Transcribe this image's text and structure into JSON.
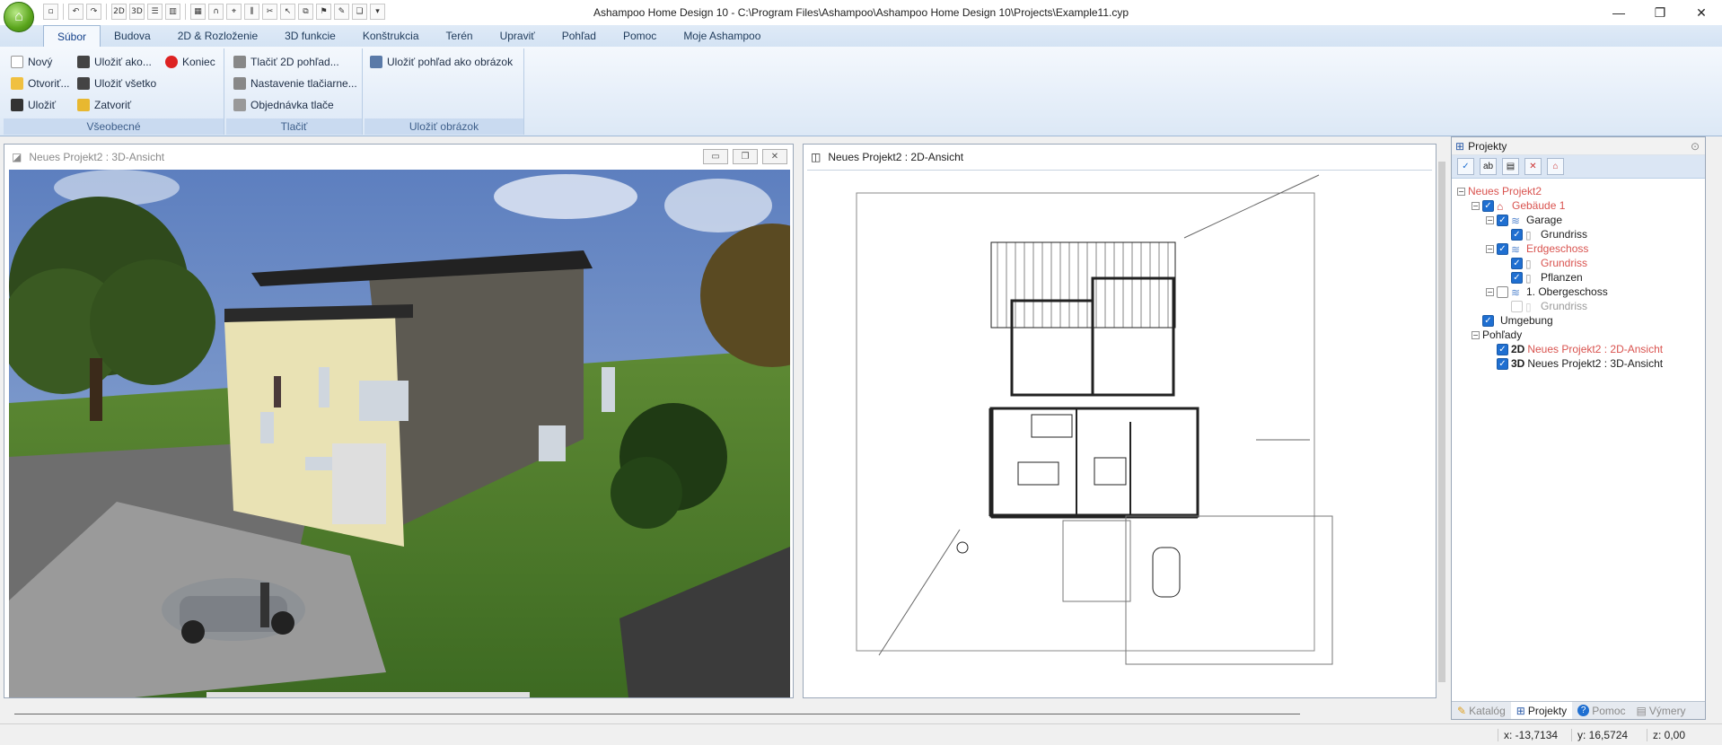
{
  "window": {
    "title": "Ashampoo Home Design 10 - C:\\Program Files\\Ashampoo\\Ashampoo Home Design 10\\Projects\\Example11.cyp",
    "minimize": "—",
    "maximize": "❐",
    "close": "✕"
  },
  "qat": {
    "btn_2d": "2D",
    "btn_3d": "3D"
  },
  "ribbon": {
    "tabs": [
      "Súbor",
      "Budova",
      "2D & Rozloženie",
      "3D funkcie",
      "Konštrukcia",
      "Terén",
      "Upraviť",
      "Pohľad",
      "Pomoc",
      "Moje Ashampoo"
    ],
    "groups": {
      "vseobecne": {
        "label": "Všeobecné",
        "items": [
          "Nový",
          "Otvoriť...",
          "Uložiť",
          "Uložiť ako...",
          "Uložiť všetko",
          "Zatvoriť",
          "Koniec"
        ]
      },
      "tlacit": {
        "label": "Tlačiť",
        "items": [
          "Tlačiť 2D pohľad...",
          "Nastavenie tlačiarne...",
          "Objednávka tlače"
        ]
      },
      "ulozit_obrazok": {
        "label": "Uložiť obrázok",
        "items": [
          "Uložiť pohľad ako obrázok"
        ]
      }
    }
  },
  "views": {
    "view3d_title": "Neues Projekt2 : 3D-Ansicht",
    "view2d_title": "Neues Projekt2 : 2D-Ansicht"
  },
  "project_panel": {
    "title": "Projekty",
    "tree": [
      {
        "label": "Neues Projekt2"
      },
      {
        "label": "Gebäude 1"
      },
      {
        "label": "Garage"
      },
      {
        "label": "Grundriss"
      },
      {
        "label": "Erdgeschoss"
      },
      {
        "label": "Grundriss"
      },
      {
        "label": "Pflanzen"
      },
      {
        "label": "1. Obergeschoss"
      },
      {
        "label": "Grundriss"
      },
      {
        "label": "Umgebung"
      },
      {
        "label": "Pohľady"
      },
      {
        "label": "Neues Projekt2 : 2D-Ansicht",
        "badge": "2D"
      },
      {
        "label": "Neues Projekt2 : 3D-Ansicht",
        "badge": "3D"
      }
    ],
    "tabs": [
      "Katalóg",
      "Projekty",
      "Pomoc",
      "Výmery"
    ]
  },
  "status": {
    "x": "x: -13,7134",
    "y": "y: 16,5724",
    "z": "z: 0,00"
  },
  "colors": {
    "accent": "#15428b",
    "ribbon": "#dce8f6",
    "highlight_red": "#d9534f"
  }
}
